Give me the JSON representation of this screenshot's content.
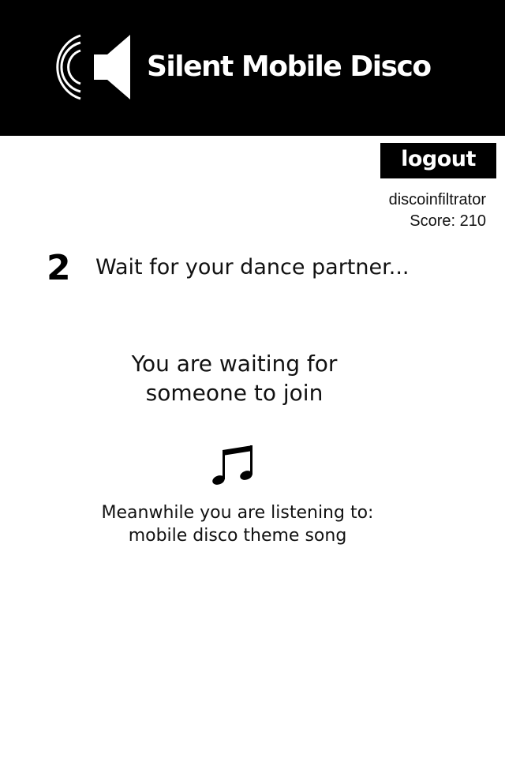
{
  "header": {
    "app_title": "Silent Mobile Disco",
    "logo_icon": "speaker-sound-icon",
    "background": "#000000",
    "text_color": "#ffffff"
  },
  "account": {
    "logout_label": "logout",
    "username": "discoinfiltrator",
    "score": "Score: 210"
  },
  "step": {
    "number": "2",
    "title": "Wait for your dance partner..."
  },
  "status": {
    "waiting_line1": "You are waiting for",
    "waiting_line2": "someone to join"
  },
  "now_playing": {
    "icon": "music-notes-icon",
    "label": "Meanwhile you are listening to:",
    "song": "mobile disco theme song"
  }
}
